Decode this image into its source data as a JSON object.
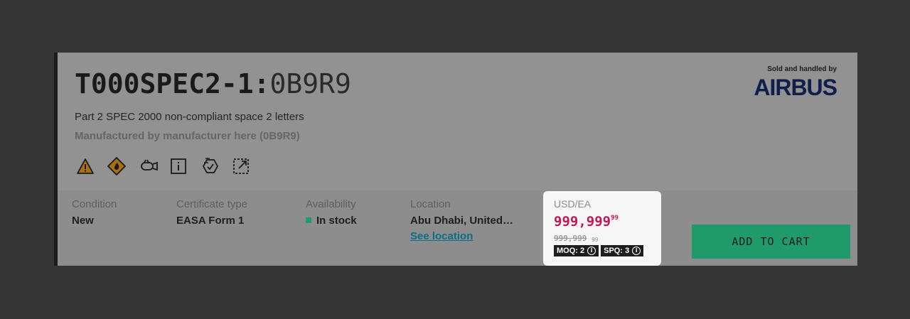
{
  "product": {
    "reference": "T000SPEC2-1:",
    "manufacturer_code": "0B9R9",
    "description": "Part 2 SPEC 2000 non-compliant space 2 letters",
    "manufacturer_line": "Manufactured by manufacturer here (0B9R9)"
  },
  "feature_icons": [
    "hazard-warning-icon",
    "flammable-icon",
    "engine-part-icon",
    "info-icon",
    "serialized-tag-icon",
    "dimensions-icon"
  ],
  "seller": {
    "label": "Sold and handled by",
    "name": "AIRBUS"
  },
  "details": {
    "condition": {
      "label": "Condition",
      "value": "New"
    },
    "certificate": {
      "label": "Certificate type",
      "value": "EASA Form 1"
    },
    "availability": {
      "label": "Availability",
      "value": "In stock"
    },
    "location": {
      "label": "Location",
      "value": "Abu Dhabi, United…",
      "link": "See location"
    }
  },
  "pricing": {
    "unit": "USD/EA",
    "price_main": "999,999",
    "price_cents": "99",
    "old_price_main": "999,999",
    "old_price_cents": "99",
    "moq": "MOQ: 2",
    "spq": "SPQ: 3"
  },
  "cart_button_label": "ADD TO CART",
  "colors": {
    "price": "#c0185a",
    "cta": "#1f9a6b",
    "link": "#0a6e88",
    "brand": "#0f1e4a"
  }
}
